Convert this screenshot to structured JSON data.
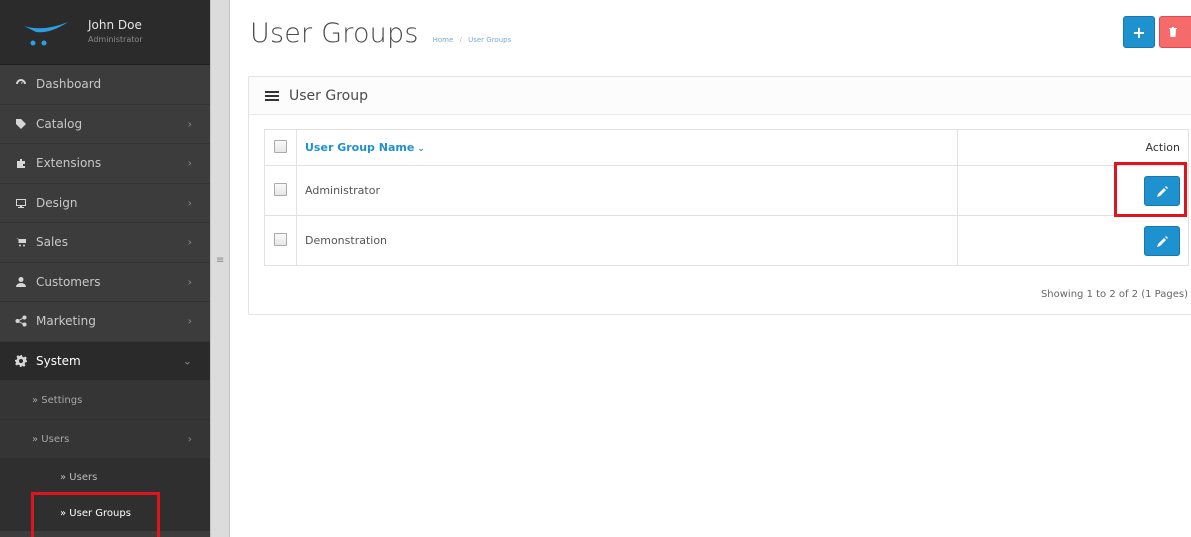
{
  "user": {
    "name": "John Doe",
    "role": "Administrator"
  },
  "menu": [
    {
      "label": "Dashboard",
      "icon": "dashboard-icon",
      "has_children": false
    },
    {
      "label": "Catalog",
      "icon": "tag-icon",
      "has_children": true
    },
    {
      "label": "Extensions",
      "icon": "puzzle-icon",
      "has_children": true
    },
    {
      "label": "Design",
      "icon": "monitor-icon",
      "has_children": true
    },
    {
      "label": "Sales",
      "icon": "cart-icon",
      "has_children": true
    },
    {
      "label": "Customers",
      "icon": "user-icon",
      "has_children": true
    },
    {
      "label": "Marketing",
      "icon": "share-icon",
      "has_children": true
    },
    {
      "label": "System",
      "icon": "gear-icon",
      "has_children": true,
      "expanded": true
    }
  ],
  "system_sub": [
    {
      "label": "» Settings"
    },
    {
      "label": "» Users"
    }
  ],
  "users_sub": [
    {
      "label": "» Users"
    },
    {
      "label": "» User Groups"
    }
  ],
  "page": {
    "title": "User Groups",
    "breadcrumb": [
      "Home",
      "User Groups"
    ],
    "breadcrumb_sep": "/"
  },
  "toolbar": {
    "add_label": "+"
  },
  "panel": {
    "title": "User Group"
  },
  "table": {
    "columns": {
      "name": "User Group Name",
      "name_sort_icon": "⌄",
      "action": "Action"
    },
    "rows": [
      {
        "name": "Administrator"
      },
      {
        "name": "Demonstration"
      }
    ],
    "pagination": "Showing 1 to 2 of 2 (1 Pages)"
  },
  "colors": {
    "primary": "#1e91cf",
    "danger": "#f56b6b",
    "sidebar": "#3c3c3c",
    "highlight": "#e0141e"
  }
}
